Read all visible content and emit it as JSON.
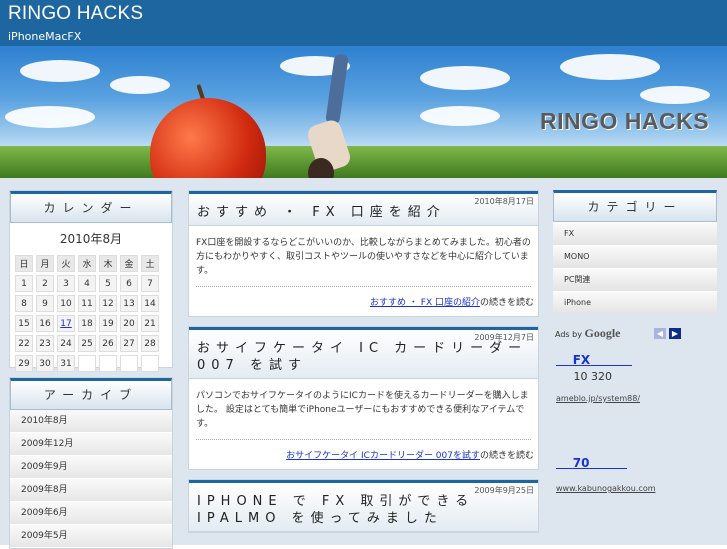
{
  "header": {
    "title": "RINGO HACKS",
    "description": "iPhoneMacFX"
  },
  "banner": {
    "logo_text": "RINGO HACKS"
  },
  "calendar": {
    "heading": "カレンダー",
    "month": "2010年8月",
    "weekdays": [
      "日",
      "月",
      "火",
      "水",
      "木",
      "金",
      "土"
    ],
    "weeks": [
      [
        "1",
        "2",
        "3",
        "4",
        "5",
        "6",
        "7"
      ],
      [
        "8",
        "9",
        "10",
        "11",
        "12",
        "13",
        "14"
      ],
      [
        "15",
        "16",
        "17",
        "18",
        "19",
        "20",
        "21"
      ],
      [
        "22",
        "23",
        "24",
        "25",
        "26",
        "27",
        "28"
      ],
      [
        "29",
        "30",
        "31",
        "",
        "",
        "",
        ""
      ]
    ],
    "linked_day": "17"
  },
  "archive": {
    "heading": "アーカイブ",
    "items": [
      "2010年8月",
      "2009年12月",
      "2009年9月",
      "2009年8月",
      "2009年6月",
      "2009年5月"
    ]
  },
  "posts": [
    {
      "date": "2010年8月17日",
      "title": "おすすめ ・ FX 口座を紹介",
      "body": "FX口座を開設するならどこがいいのか、比較しながらまとめてみました。初心者の方にもわかりやすく、取引コストやツールの使いやすさなどを中心に紹介しています。",
      "more_link": "おすすめ ・ FX 口座の紹介",
      "more_suffix": "の続きを読む"
    },
    {
      "date": "2009年12月7日",
      "title": "おサイフケータイ IC カードリーダー 007 を試す",
      "body": "パソコンでおサイフケータイのようにICカードを使えるカードリーダーを購入しました。 設定はとても簡単でiPhoneユーザーにもおすすめできる便利なアイテムです。",
      "more_link": "おサイフケータイ ICカードリーダー 007を試す",
      "more_suffix": "の続きを読む"
    },
    {
      "date": "2009年9月25日",
      "title": "IPHONE で FX 取引ができる IPALMO を使ってみました",
      "body": "",
      "more_link": "",
      "more_suffix": ""
    }
  ],
  "categories": {
    "heading": "カテゴリー",
    "items": [
      "FX",
      "MONO",
      "PC関連",
      "iPhone"
    ]
  },
  "ads": {
    "label": "Ads by",
    "brand": "Google",
    "prev_icon": "chevron-left-icon",
    "next_icon": "chevron-right-icon",
    "items": [
      {
        "title": "FX",
        "text": "10 320",
        "url": "ameblo.jp/system88/"
      },
      {
        "title": "70",
        "text": "",
        "url": "www.kabunogakkou.com"
      }
    ]
  },
  "colors": {
    "header_bg": "#1d66a0",
    "link": "#1a33cc",
    "page_bg": "#dde6ee"
  }
}
